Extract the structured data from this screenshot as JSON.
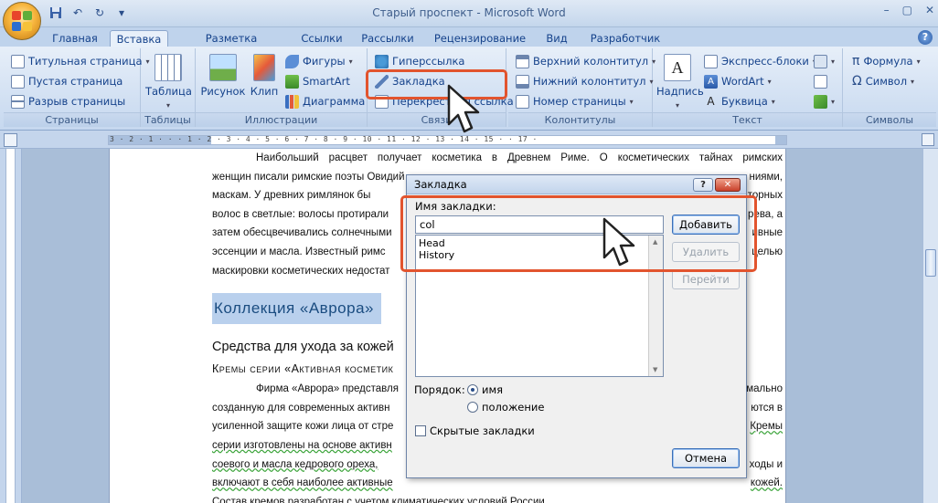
{
  "window": {
    "title": "Старый проспект - Microsoft Word",
    "controls": [
      "–",
      "▢",
      "✕"
    ]
  },
  "tabs": [
    "Главная",
    "Вставка",
    "Разметка страницы",
    "Ссылки",
    "Рассылки",
    "Рецензирование",
    "Вид",
    "Разработчик"
  ],
  "active_tab": "Вставка",
  "ribbon": {
    "pages": {
      "label": "Страницы",
      "items": [
        "Титульная страница",
        "Пустая страница",
        "Разрыв страницы"
      ]
    },
    "tables": {
      "label": "Таблицы",
      "table": "Таблица"
    },
    "illustrations": {
      "label": "Иллюстрации",
      "picture": "Рисунок",
      "clip": "Клип",
      "shapes": "Фигуры",
      "smartart": "SmartArt",
      "chart": "Диаграмма"
    },
    "links": {
      "label": "Связи",
      "hyperlink": "Гиперссылка",
      "bookmark": "Закладка",
      "crossref": "Перекрестная ссылка"
    },
    "header_footer": {
      "label": "Колонтитулы",
      "header": "Верхний колонтитул",
      "footer": "Нижний колонтитул",
      "page_number": "Номер страницы"
    },
    "text": {
      "label": "Текст",
      "textbox": "Надпись",
      "quickparts": "Экспресс-блоки",
      "wordart": "WordArt",
      "dropcap": "Буквица"
    },
    "symbols": {
      "label": "Символы",
      "formula": "Формула",
      "symbol": "Символ"
    }
  },
  "ruler": {
    "h_text": "3 · 2 · 1 ·  ·  · 1 · 2 · 3 · 4 · 5 · 6 · 7 · 8 · 9 · 10 · 11 · 12 · 13 · 14 · 15 ·  · 17 ·"
  },
  "document": {
    "p1": "Наибольший расцвет получает косметика в Древнем Риме. О косметических тайнах римских женщин писали римские поэты Овидий и Марциал. Римлянки лечили кожу лица различными мазями, масками. У древних римлянок были распространены средства для обесцвечивания волос, в светлые: волосы протирались особыми составами, рецепты которых хранились в секрете, а затем обесцвечивались солнечными лучами. Часто использовались ароматические благовонные эссенции и масла. Известный римский врач Гален специально для изготовления мази с целью маскировки косметических недостатков.",
    "p1_lines": [
      "Наибольший расцвет получает косметика в Древнем Риме. О косметических тайнах римских",
      "женщин писали римские поэты Овидий",
      "маскам. У древних римлянок бы",
      "волос в светлые: волосы протирали",
      "затем обесцвечивались солнечными",
      "эссенции и масла. Известный римс",
      "маскировки косметических недостат"
    ],
    "heading1": "Коллекция «Аврора»",
    "heading2": "Средства для ухода за кожей",
    "heading3": "Кремы серии «Активная косметик",
    "p2_lines": [
      "Фирма «Аврора» представля",
      "созданную для современных активн",
      "усиленной защите кожи лица от стре",
      "серии изготовлены на основе активн",
      "соевого и масла кедрового ореха,",
      "включают в себя наиболее активные",
      "Состав кремов разработан с учетом климатических условий России."
    ],
    "p1_right": [
      "",
      "ниями,",
      "торных",
      "рева, а",
      "ивные",
      "целью",
      ""
    ],
    "p2_right": [
      "мально",
      "ются в",
      "Кремы",
      "ходы и",
      "кожей.",
      "",
      ""
    ]
  },
  "dialog": {
    "title": "Закладка",
    "name_label": "Имя закладки:",
    "name_value": "col",
    "bookmarks": [
      "Head",
      "History"
    ],
    "add_button": "Добавить",
    "delete_button": "Удалить",
    "goto_button": "Перейти",
    "sort_label": "Порядок:",
    "sort_name": "имя",
    "sort_position": "положение",
    "hidden_label": "Скрытые закладки",
    "cancel_button": "Отмена",
    "help": "?",
    "close": "✕"
  },
  "colors": {
    "highlight": "#e2542e",
    "ribbon_text": "#15428b"
  }
}
